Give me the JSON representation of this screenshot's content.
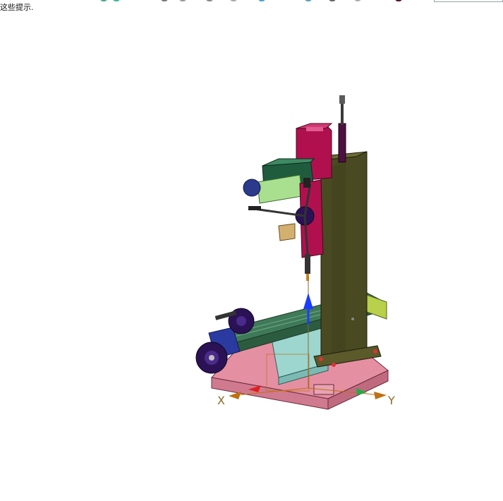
{
  "status": {
    "hint_text": "这些提示."
  },
  "toolbar": {
    "icons": [
      "view-icon",
      "refresh-icon",
      "rotate-icon",
      "pan-icon",
      "zoom-icon",
      "select-icon",
      "measure-icon",
      "section-icon",
      "render-icon",
      "settings-icon"
    ]
  },
  "viewport": {
    "axis_x_label": "X",
    "axis_y_label": "Y",
    "colors": {
      "column": "#4a4a22",
      "base": "#e58fa3",
      "table": "#2f6b4a",
      "motor": "#b0104e",
      "head": "#1f5c3e",
      "handwheel": "#2b1255",
      "axis_z": "#1b3cff",
      "axis_x": "#e02020",
      "axis_y": "#22aa44"
    }
  }
}
